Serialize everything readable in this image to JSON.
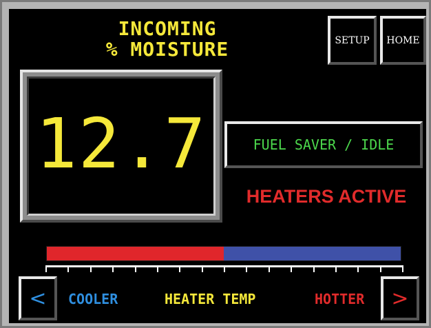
{
  "title": {
    "line1": "INCOMING",
    "line2": "% MOISTURE",
    "color": "#f5e83a"
  },
  "buttons": {
    "setup_label": "SETUP",
    "home_label": "HOME"
  },
  "readout": {
    "value": "12.7",
    "color": "#f5e83a"
  },
  "mode": {
    "label": "FUEL SAVER / IDLE",
    "color": "#4cd84c"
  },
  "status": {
    "text": "HEATERS ACTIVE",
    "color": "#e12b2b"
  },
  "heater_bar": {
    "level_fraction": 0.5,
    "hot_color": "#e0262b",
    "cool_color": "#3f51a8",
    "tick_count": 17
  },
  "scale": {
    "left_arrow": "<",
    "right_arrow": ">",
    "cooler_label": "COOLER",
    "center_label": "HEATER TEMP",
    "hotter_label": "HOTTER",
    "cooler_color": "#2f8fe0",
    "hotter_color": "#e12b2b"
  }
}
